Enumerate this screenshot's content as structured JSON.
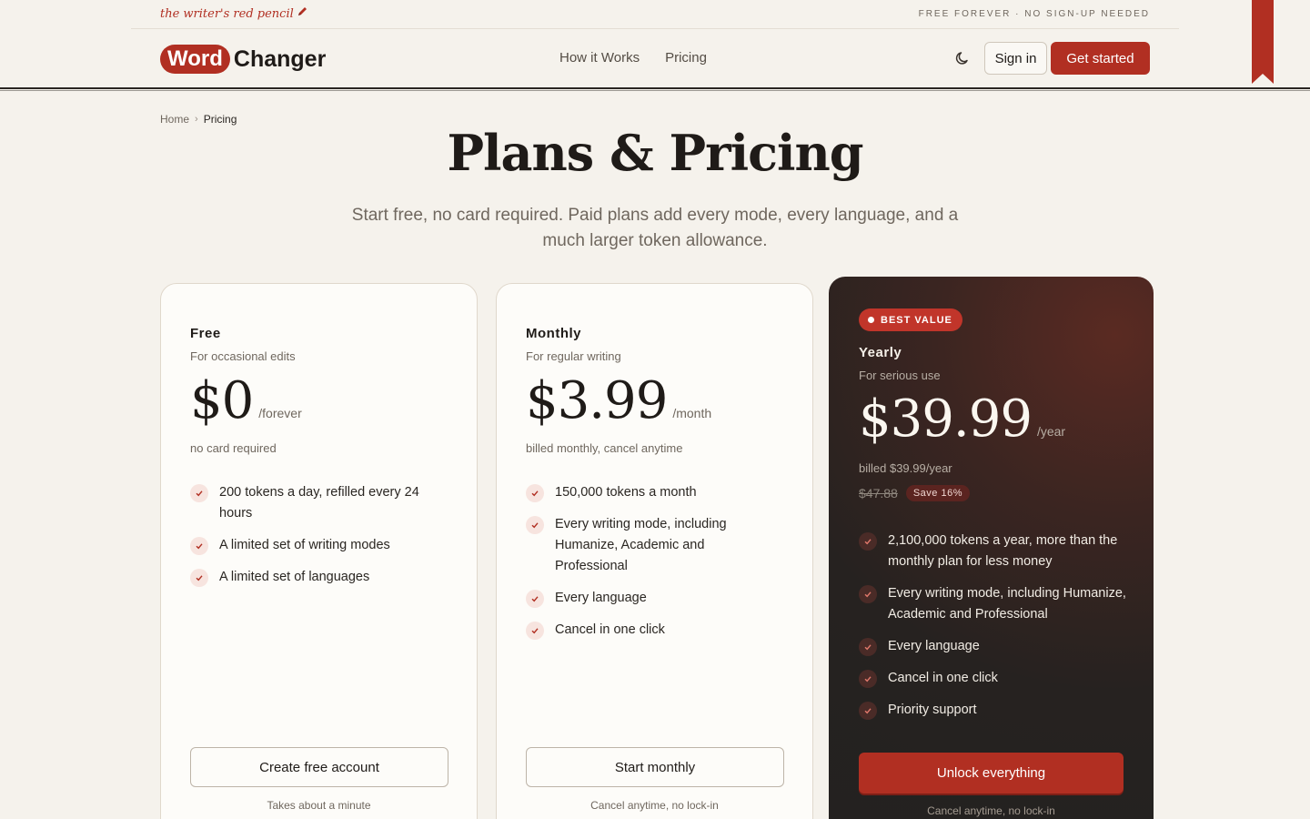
{
  "topstrip": {
    "tagline": "the writer's red pencil",
    "notice": "FREE FOREVER · NO SIGN-UP NEEDED"
  },
  "brand": {
    "word": "Word",
    "changer": "Changer",
    "accent": "#b12f22"
  },
  "nav": {
    "items": [
      "How it Works",
      "Pricing"
    ]
  },
  "header": {
    "sign_in": "Sign in",
    "get_started": "Get started"
  },
  "breadcrumb": {
    "home": "Home",
    "current": "Pricing"
  },
  "page": {
    "title": "Plans & Pricing",
    "subtitle": "Start free, no card required. Paid plans add every mode, every language, and a much larger token allowance."
  },
  "plans": [
    {
      "name": "Free",
      "description": "For occasional edits",
      "price": "$0",
      "period": "/forever",
      "billed": "no card required",
      "features": [
        "200 tokens a day, refilled every 24 hours",
        "A limited set of writing modes",
        "A limited set of languages"
      ],
      "cta": "Create free account",
      "cta_note": "Takes about a minute"
    },
    {
      "name": "Monthly",
      "description": "For regular writing",
      "price": "$3.99",
      "period": "/month",
      "billed": "billed monthly, cancel anytime",
      "features": [
        "150,000 tokens a month",
        "Every writing mode, including Humanize, Academic and Professional",
        "Every language",
        "Cancel in one click"
      ],
      "cta": "Start monthly",
      "cta_note": "Cancel anytime, no lock-in"
    },
    {
      "badge": "BEST VALUE",
      "name": "Yearly",
      "description": "For serious use",
      "price": "$39.99",
      "period": "/year",
      "billed": "billed $39.99/year",
      "old_price": "$47.88",
      "save": "Save 16%",
      "features": [
        "2,100,000 tokens a year, more than the monthly plan for less money",
        "Every writing mode, including Humanize, Academic and Professional",
        "Every language",
        "Cancel in one click",
        "Priority support"
      ],
      "cta": "Unlock everything",
      "cta_note": "Cancel anytime, no lock-in"
    }
  ],
  "icons": {
    "pencil": "pencil-icon",
    "theme": "moon-icon",
    "check": "check-icon",
    "ribbon": "bookmark-ribbon-icon",
    "breadcrumb_sep": "chevron-right-icon"
  }
}
